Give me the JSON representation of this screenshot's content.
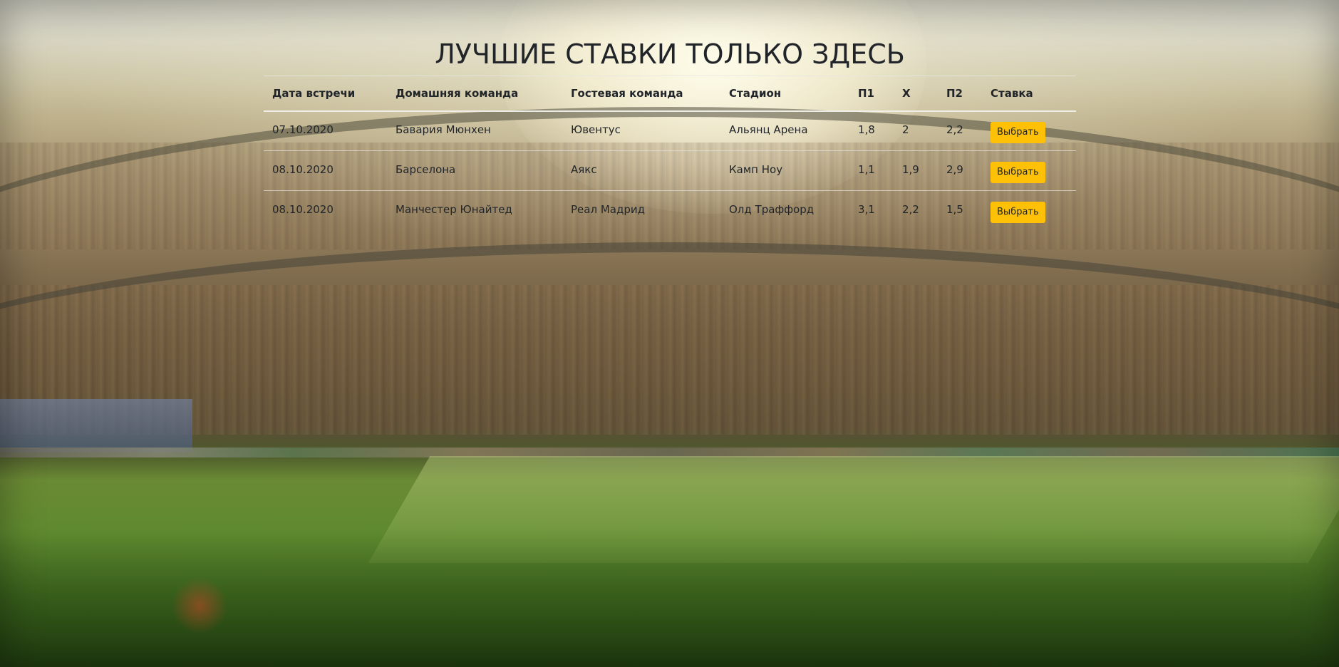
{
  "page": {
    "heading": "ЛУЧШИЕ СТАВКИ ТОЛЬКО ЗДЕСЬ"
  },
  "table": {
    "headers": [
      "Дата встречи",
      "Домашняя команда",
      "Гостевая команда",
      "Стадион",
      "П1",
      "X",
      "П2",
      "Ставка"
    ],
    "rows": [
      {
        "date": "07.10.2020",
        "home": "Бавария Мюнхен",
        "away": "Ювентус",
        "stadium": "Альянц Арена",
        "p1": "1,8",
        "x": "2",
        "p2": "2,2",
        "action": "Выбрать"
      },
      {
        "date": "08.10.2020",
        "home": "Барселона",
        "away": "Аякс",
        "stadium": "Камп Ноу",
        "p1": "1,1",
        "x": "1,9",
        "p2": "2,9",
        "action": "Выбрать"
      },
      {
        "date": "08.10.2020",
        "home": "Манчестер Юнайтед",
        "away": "Реал Мадрид",
        "stadium": "Олд Траффорд",
        "p1": "3,1",
        "x": "2,2",
        "p2": "1,5",
        "action": "Выбрать"
      }
    ]
  },
  "colors": {
    "text": "#212529",
    "button": "#ffc107"
  },
  "background": {
    "description_icon": "stadium-background"
  }
}
